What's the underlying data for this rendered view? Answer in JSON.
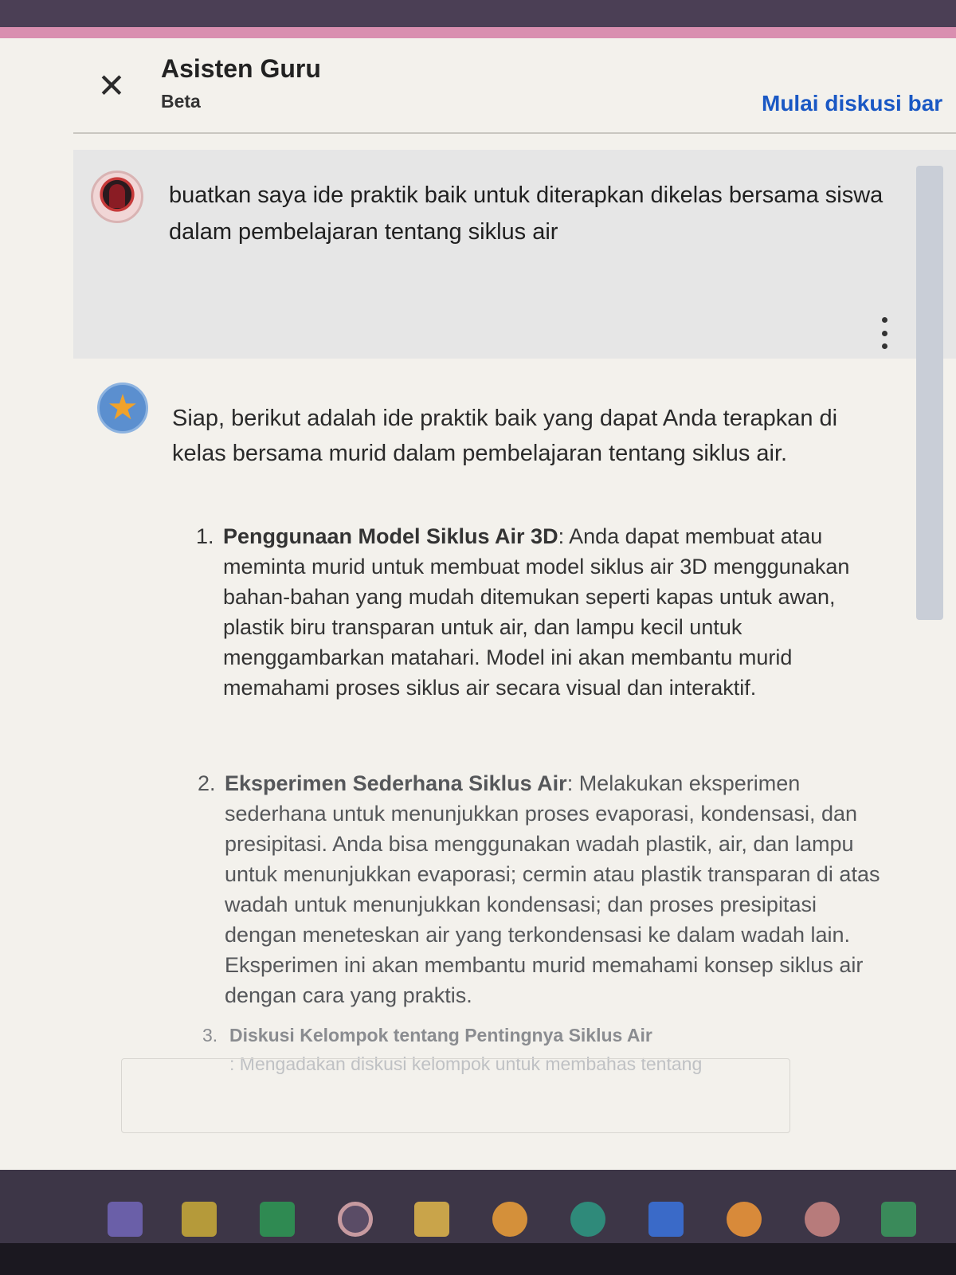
{
  "header": {
    "close_label": "✕",
    "title": "Asisten Guru",
    "subtitle": "Beta",
    "new_discussion_label": "Mulai diskusi bar"
  },
  "user_message": {
    "text": "buatkan saya ide praktik baik untuk diterapkan dikelas bersama siswa dalam pembelajaran tentang siklus air",
    "more_icon": "more-vertical-icon"
  },
  "assistant_message": {
    "avatar_icon": "star-icon",
    "intro": "Siap, berikut adalah ide praktik baik yang dapat Anda terapkan di kelas bersama murid dalam pembelajaran tentang siklus air.",
    "items": [
      {
        "number": "1.",
        "title": "Penggunaan Model Siklus Air 3D",
        "body": ": Anda dapat membuat atau meminta murid untuk membuat model siklus air 3D menggunakan bahan-bahan yang mudah ditemukan seperti kapas untuk awan, plastik biru transparan untuk air, dan lampu kecil untuk menggambarkan matahari. Model ini akan membantu murid memahami proses siklus air secara visual dan interaktif."
      },
      {
        "number": "2.",
        "title": "Eksperimen Sederhana Siklus Air",
        "body": ": Melakukan eksperimen sederhana untuk menunjukkan proses evaporasi, kondensasi, dan presipitasi. Anda bisa menggunakan wadah plastik, air, dan lampu untuk menunjukkan evaporasi; cermin atau plastik transparan di atas wadah untuk menunjukkan kondensasi; dan proses presipitasi dengan meneteskan air yang terkondensasi ke dalam wadah lain. Eksperimen ini akan membantu murid memahami konsep siklus air dengan cara yang praktis."
      },
      {
        "number": "3.",
        "title": "Diskusi Kelompok tentang Pentingnya Siklus Air",
        "body": ": Mengadakan diskusi kelompok untuk membahas tentang"
      }
    ]
  },
  "taskbar": {
    "icons": [
      "teams-icon",
      "media-icon",
      "excel-icon",
      "circle-app-icon",
      "file-explorer-icon",
      "chrome-icon",
      "edge-icon",
      "word-icon",
      "chrome-icon",
      "browser-icon",
      "app-icon"
    ]
  }
}
